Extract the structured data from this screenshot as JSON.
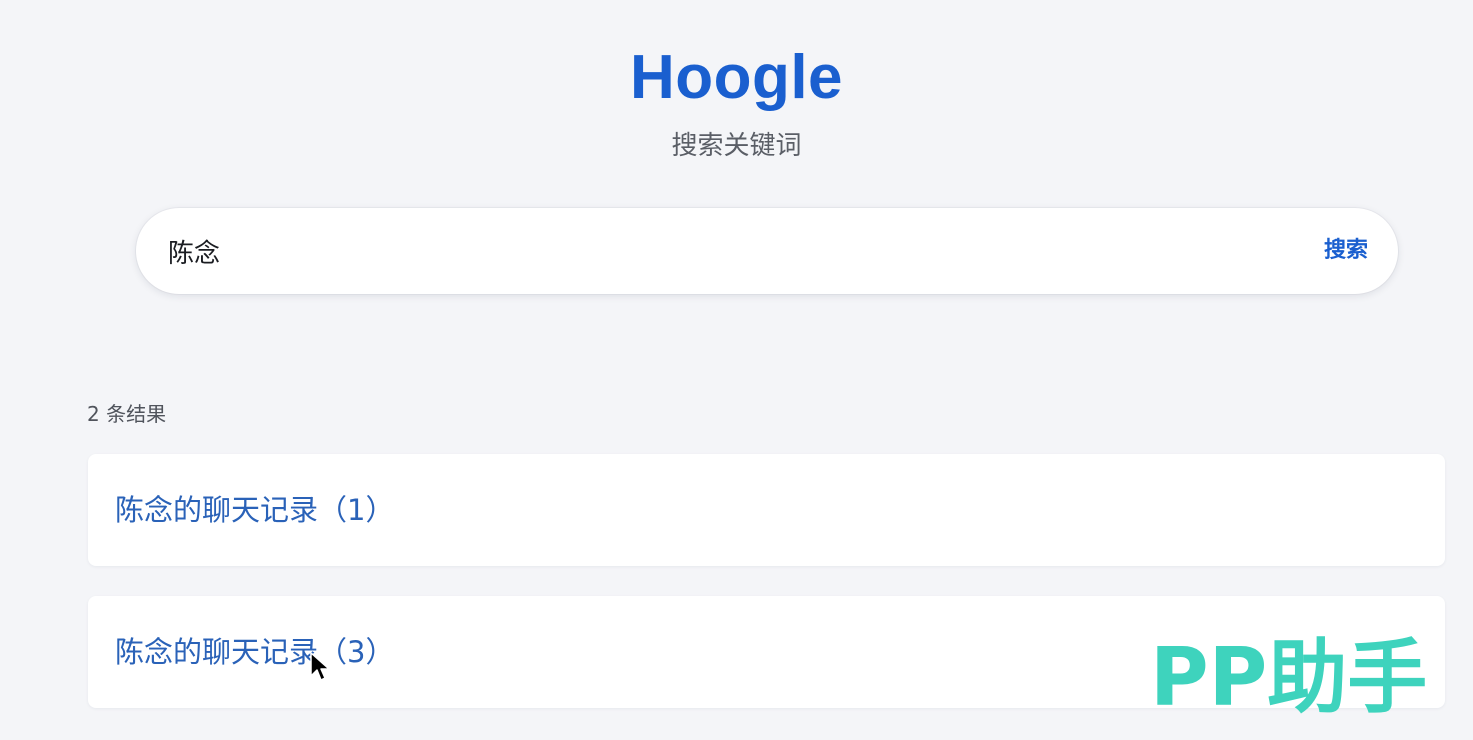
{
  "brand": {
    "title": "Hoogle",
    "subtitle": "搜索关键词"
  },
  "search": {
    "query": "陈念",
    "button_label": "搜索"
  },
  "results": {
    "count_label": "2 条结果",
    "items": [
      {
        "title": "陈念的聊天记录（1）"
      },
      {
        "title": "陈念的聊天记录（3）"
      }
    ]
  },
  "watermark": {
    "text": "PP助手"
  },
  "colors": {
    "brand": "#1a5fcf",
    "link": "#2a62b8",
    "background": "#f4f5f8",
    "watermark": "#3ed3bd"
  }
}
